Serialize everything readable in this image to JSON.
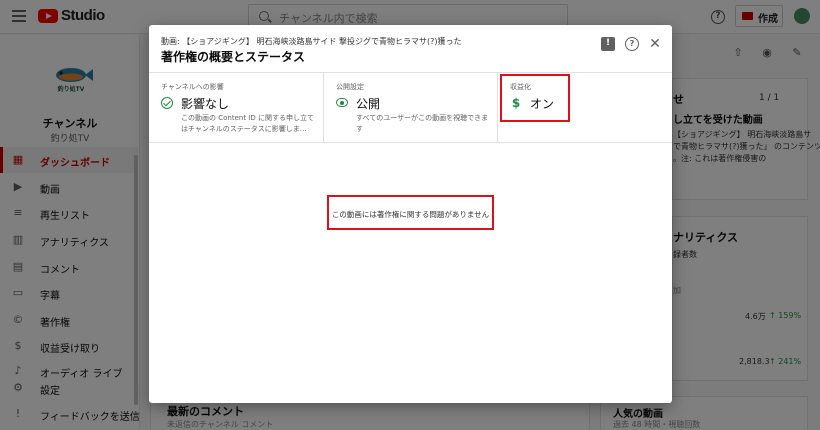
{
  "app": {
    "studio_label": "Studio",
    "search_placeholder": "チャンネル内で検索",
    "create_label": "作成",
    "help_glyph": "?"
  },
  "sidebar": {
    "channel_title": "チャンネル",
    "channel_name": "釣り処TV",
    "avatar_text": "釣り処TV",
    "items": [
      {
        "label": "ダッシュボード",
        "icon": "grid-icon",
        "glyph": "▦",
        "active": true
      },
      {
        "label": "動画",
        "icon": "video-library-icon",
        "glyph": "▶",
        "active": false
      },
      {
        "label": "再生リスト",
        "icon": "playlist-icon",
        "glyph": "≡",
        "active": false
      },
      {
        "label": "アナリティクス",
        "icon": "analytics-icon",
        "glyph": "▥",
        "active": false
      },
      {
        "label": "コメント",
        "icon": "comment-icon",
        "glyph": "▤",
        "active": false
      },
      {
        "label": "字幕",
        "icon": "subtitles-icon",
        "glyph": "▭",
        "active": false
      },
      {
        "label": "著作権",
        "icon": "copyright-icon",
        "glyph": "©",
        "active": false
      },
      {
        "label": "収益受け取り",
        "icon": "dollar-icon",
        "glyph": "$",
        "active": false
      },
      {
        "label": "オーディオ ライブ",
        "icon": "audio-icon",
        "glyph": "♪",
        "active": false
      },
      {
        "label": "設定",
        "icon": "settings-icon",
        "glyph": "⚙",
        "active": false
      },
      {
        "label": "フィードバックを送信",
        "icon": "feedback-icon",
        "glyph": "!",
        "active": false
      }
    ]
  },
  "background": {
    "news_heading": "せ",
    "news_pager": "1 / 1",
    "claim_title": "し立てを受けた動画",
    "claim_line1": "【ショアジギング】 明石海峡淡路島サ",
    "claim_line2": "で青物ヒラマサ(?)獲った」 のコンテンツ",
    "claim_line3": "。注: これは著作権侵害の",
    "analytics_heading": "ナリティクス",
    "analytics_sub": "録者数",
    "analytics_link": "加",
    "stat1_value": "4.6万",
    "stat1_change": "↑ 159%",
    "stat2_value": "2,818.3",
    "stat2_change": "↑ 241%",
    "comments_heading": "最新のコメント",
    "comments_sub": "未返信のチャンネル コメント",
    "popular_heading": "人気の動画",
    "popular_sub": "過去 48 時間・視聴回数"
  },
  "dialog": {
    "subtitle": "動画: 【ショアジギング】 明石海峡淡路島サイド 撃投ジグで青物ヒラマサ(?)獲った",
    "title": "著作権の概要とステータス",
    "help_glyph": "?",
    "close_glyph": "✕",
    "columns": [
      {
        "label": "チャンネルへの影響",
        "value": "影響なし",
        "icon": "check-circle-icon",
        "description": "この動画の Content ID に関する申し立てはチャンネルのステータスに影響しま…"
      },
      {
        "label": "公開設定",
        "value": "公開",
        "icon": "eye-icon",
        "description": "すべてのユーザーがこの動画を視聴できます"
      },
      {
        "label": "収益化",
        "value": "オン",
        "icon": "dollar-icon",
        "description": ""
      }
    ],
    "empty_message": "この動画には著作権に関する問題がありません"
  },
  "colors": {
    "accent_red": "#cc0000",
    "status_green": "#1e8e3e",
    "highlight_red": "#e0101a"
  }
}
